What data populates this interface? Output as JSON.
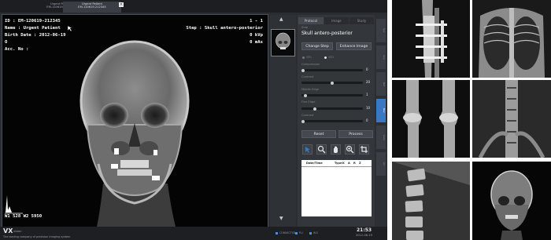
{
  "patient_tabs": [
    {
      "line1": "Urgent Patient",
      "line2": "EM-120619-212345"
    },
    {
      "line1": "Urgent Patient",
      "line2": "EM-120619-212345"
    }
  ],
  "overlay": {
    "id_line": "ID : EM-120619-212345",
    "name_line": "Name : Urgent Patient",
    "birth_line": "Birth Date : 2012-06-19",
    "field_o": "O",
    "acc_line": "Acc. No :",
    "index": "1 - 1",
    "step_line": "Step : Skull antero-posterior",
    "kvp": "0 kVp",
    "mas": "0 mAs",
    "window": "W1 528  W2 5950"
  },
  "panel": {
    "tabs": [
      "Protocol",
      "Image",
      "Study"
    ],
    "step_label": "Step",
    "step_title": "Skull antero-posterior",
    "change_step": "Change Step",
    "enhance_image": "Enhance Image",
    "radio_a": "VE1",
    "radio_b": "VE2",
    "sliders": [
      {
        "label": "Compression",
        "value": "0"
      },
      {
        "label": "Contrast",
        "value": "20"
      },
      {
        "label": "Middle Edge",
        "value": "1"
      },
      {
        "label": "Fine Edge",
        "value": "10"
      },
      {
        "label": "Contrast",
        "value": "0"
      }
    ],
    "reset": "Reset",
    "process": "Process",
    "table_headers": [
      "Date/Time",
      "Type",
      "K",
      "A",
      "R",
      "Z"
    ]
  },
  "side_tabs": [
    "Sys",
    "Acq",
    "Ref",
    "Rev",
    "Lock",
    "Arr"
  ],
  "status": {
    "brand": "VX",
    "brand_sub": "vision",
    "tagline": "The leading company of precision imaging system",
    "indicators": [
      "CONNECTED",
      "P.U",
      "W.S"
    ],
    "time": "21:53",
    "date": "2012-06-19"
  },
  "gallery": [
    {
      "name": "Leg X-ray with fixator"
    },
    {
      "name": "Chest X-ray"
    },
    {
      "name": "Knees X-ray"
    },
    {
      "name": "Pelvis spine X-ray"
    },
    {
      "name": "Lumbar spine lateral X-ray"
    },
    {
      "name": "Skull AP X-ray"
    }
  ],
  "colors": {
    "app_bg": "#2a2d31",
    "viewer_bg": "#040404",
    "panel_bg": "#33363b",
    "accent_tab": "#3a78c4"
  }
}
